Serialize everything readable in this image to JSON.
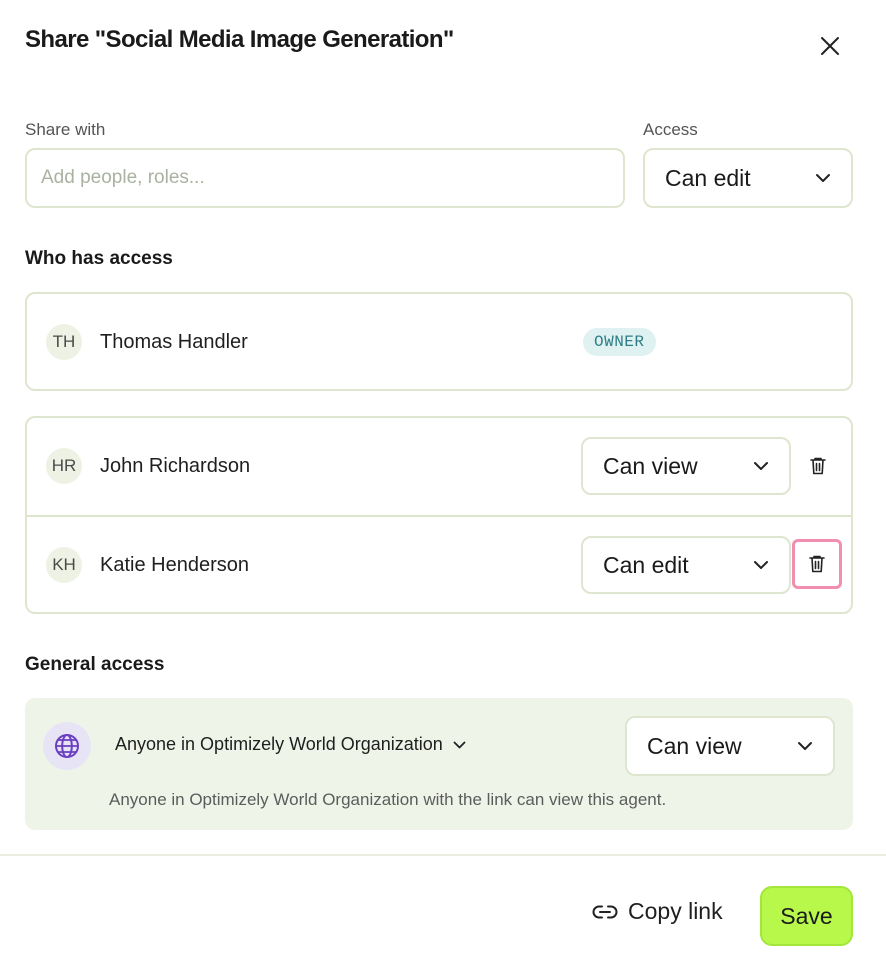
{
  "dialog": {
    "title": "Share \"Social Media Image Generation\""
  },
  "share": {
    "label": "Share with",
    "placeholder": "Add people, roles...",
    "value": "",
    "access_label": "Access",
    "access_value": "Can edit"
  },
  "who_has_access": {
    "heading": "Who has access",
    "owner": {
      "initials": "TH",
      "name": "Thomas Handler",
      "badge": "OWNER"
    },
    "members": [
      {
        "initials": "HR",
        "name": "John Richardson",
        "permission": "Can view"
      },
      {
        "initials": "KH",
        "name": "Katie Henderson",
        "permission": "Can edit"
      }
    ]
  },
  "general_access": {
    "heading": "General access",
    "scope": "Anyone in Optimizely World Organization",
    "permission": "Can view",
    "description": "Anyone in Optimizely World Organization with the link can view this agent."
  },
  "footer": {
    "copy_link_label": "Copy link",
    "save_label": "Save"
  },
  "colors": {
    "accent": "#b7f84a",
    "border": "#dfe6cf",
    "general_bg": "#eff4e8",
    "owner_badge_bg": "#dff1f1",
    "owner_badge_text": "#2d7e87",
    "focus_ring": "#f28fb0",
    "globe": "#6b3fc0"
  },
  "icons": {
    "close": "close-icon",
    "chevron": "chevron-down-icon",
    "trash": "trash-icon",
    "globe": "globe-icon",
    "link": "link-icon"
  }
}
